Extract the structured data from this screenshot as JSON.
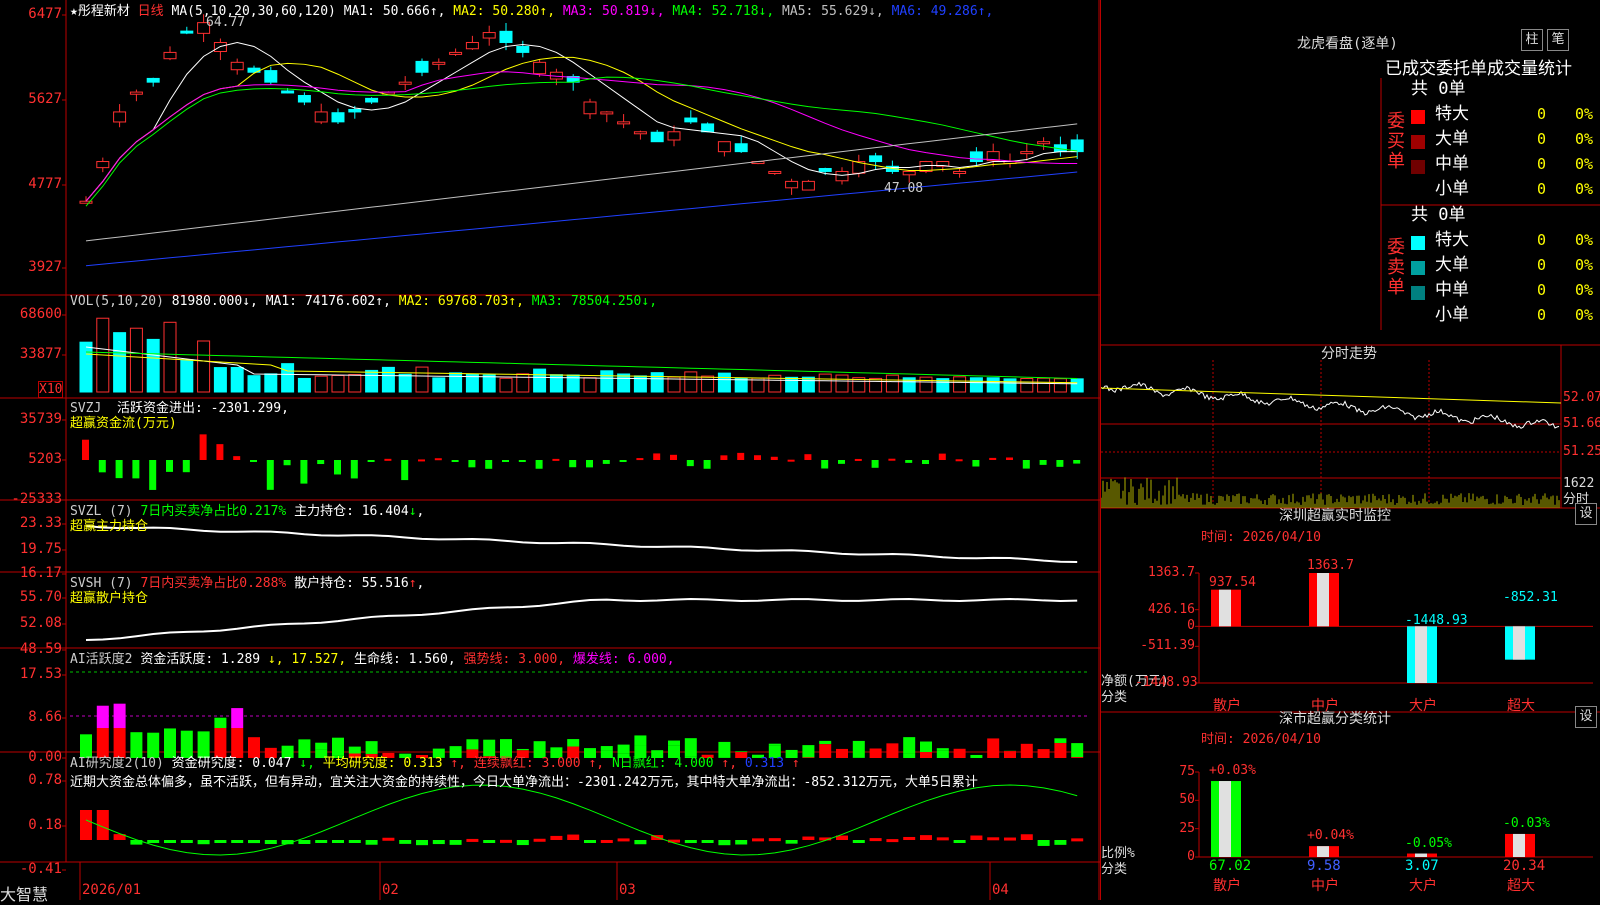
{
  "app": {
    "name": "大智慧",
    "stock": "★彤程新材",
    "period": "日线"
  },
  "main_chart": {
    "ma_label": "MA(5,10,20,30,60,120)",
    "ma": [
      {
        "name": "MA1",
        "value": "50.666",
        "arrow": "↑",
        "color": "#ffffff"
      },
      {
        "name": "MA2",
        "value": "50.280",
        "arrow": "↑",
        "color": "#ffff00"
      },
      {
        "name": "MA3",
        "value": "50.819",
        "arrow": "↓",
        "color": "#ff00ff"
      },
      {
        "name": "MA4",
        "value": "52.718",
        "arrow": "↓",
        "color": "#00ff00"
      },
      {
        "name": "MA5",
        "value": "55.629",
        "arrow": "↓",
        "color": "#c0c0c0"
      },
      {
        "name": "MA6",
        "value": "49.286",
        "arrow": "↑",
        "color": "#2040ff"
      }
    ],
    "yticks": [
      "6477",
      "5627",
      "4777",
      "3927"
    ],
    "high_label": "64.77",
    "low_label": "47.08"
  },
  "vol_panel": {
    "label": "VOL(5,10,20)",
    "value": "81980.000",
    "values": [
      {
        "name": "MA1",
        "value": "74176.602",
        "arrow": "↑",
        "color": "#ffffff"
      },
      {
        "name": "MA2",
        "value": "69768.703",
        "arrow": "↑",
        "color": "#ffff00"
      },
      {
        "name": "MA3",
        "value": "78504.250",
        "arrow": "↓",
        "color": "#00ff00"
      }
    ],
    "yticks": [
      "68600",
      "33877"
    ],
    "unit": "X10"
  },
  "svzj_panel": {
    "label": "SVZJ",
    "desc": "活跃资金进出:",
    "value": "-2301.299",
    "sub": "超赢资金流(万元)",
    "yticks": [
      "35739",
      "5203",
      "-25333"
    ]
  },
  "svzl_panel": {
    "label": "SVZL (7)",
    "desc": "7日内买卖净占比0.217%",
    "extra": "主力持仓: 16.404",
    "arrow": "↓",
    "sub": "超赢主力持仓",
    "yticks": [
      "23.33",
      "19.75",
      "16.17"
    ]
  },
  "svsh_panel": {
    "label": "SVSH (7)",
    "desc": "7日内买卖净占比0.288%",
    "extra": "散户持仓: 55.516",
    "arrow": "↑",
    "sub": "超赢散户持仓",
    "yticks": [
      "55.70",
      "52.08",
      "48.59"
    ]
  },
  "ai1_panel": {
    "label": "AI活跃度2",
    "items": [
      {
        "text": "资金活跃度: 1.289",
        "color": "#ffffff"
      },
      {
        "text": "↓, 17.527,",
        "color": "#ffff00"
      },
      {
        "text": "生命线: 1.560,",
        "color": "#ffffff"
      },
      {
        "text": "强势线: 3.000,",
        "color": "#ff3030"
      },
      {
        "text": "爆发线: 6.000,",
        "color": "#ff00ff"
      }
    ],
    "yticks": [
      "17.53",
      "8.66",
      "0.00"
    ]
  },
  "ai2_panel": {
    "label": "AI研究度2(10)",
    "items": [
      {
        "text": "资金研究度: 0.047",
        "color": "#ffffff"
      },
      {
        "text": "↓,",
        "color": "#00ff00"
      },
      {
        "text": "平均研究度: 0.313",
        "color": "#ffff00"
      },
      {
        "text": "↑,",
        "color": "#ff3030"
      },
      {
        "text": "连续飘红: 3.000",
        "color": "#ff3030"
      },
      {
        "text": "↑,",
        "color": "#ff3030"
      },
      {
        "text": "N日飘红: 4.000",
        "color": "#00ff00"
      },
      {
        "text": "↑,",
        "color": "#ff3030"
      },
      {
        "text": "0.313",
        "color": "#2040ff"
      },
      {
        "text": "↑",
        "color": "#ff3030"
      }
    ],
    "comment": "近期大资金总体偏多，虽不活跃，但有异动，宜关注大资金的持续性，今日大单净流出：-2301.242万元，其中特大单净流出：-852.312万元，大单5日累计",
    "yticks": [
      "0.78",
      "0.18",
      "-0.41"
    ]
  },
  "xaxis": [
    "2026/01",
    "02",
    "03",
    "04"
  ],
  "side": {
    "lhb": {
      "title": "龙虎看盘(逐单)",
      "btn1": "柱",
      "btn2": "笔",
      "tabs": "已成交委托单成交量统计",
      "buy": {
        "label": "委买单",
        "total": "共 0单",
        "rows": [
          {
            "name": "特大",
            "count": "0",
            "pct": "0%",
            "color": "#ff0000"
          },
          {
            "name": "大单",
            "count": "0",
            "pct": "0%",
            "color": "#a00000"
          },
          {
            "name": "中单",
            "count": "0",
            "pct": "0%",
            "color": "#700000"
          },
          {
            "name": "小单",
            "count": "0",
            "pct": "0%",
            "color": "#000000"
          }
        ]
      },
      "sell": {
        "label": "委卖单",
        "total": "共 0单",
        "rows": [
          {
            "name": "特大",
            "count": "0",
            "pct": "0%",
            "color": "#00ffff"
          },
          {
            "name": "大单",
            "count": "0",
            "pct": "0%",
            "color": "#00a0a0"
          },
          {
            "name": "中单",
            "count": "0",
            "pct": "0%",
            "color": "#008080"
          },
          {
            "name": "小单",
            "count": "0",
            "pct": "0%",
            "color": "#000000"
          }
        ]
      }
    },
    "fenshi": {
      "title": "分时走势",
      "yticks": [
        "52.07",
        "51.66",
        "51.25"
      ],
      "vol_tick": "1622",
      "vol_unit": "分时"
    },
    "sz_monitor": {
      "title": "深圳超赢实时监控",
      "btn": "设",
      "time": "时间: 2026/04/10",
      "yticks": [
        "1363.7",
        "426.16",
        "0",
        "-511.39",
        "-1448.93"
      ],
      "ylabel": "净额(万元)",
      "xlabel_title": "分类",
      "categories": [
        "散户",
        "中户",
        "大户",
        "超大"
      ],
      "values": [
        937.54,
        1363.7,
        -1448.93,
        -852.31
      ],
      "value_labels": [
        "937.54",
        "1363.7",
        "-1448.93",
        "-852.31"
      ],
      "ylim": [
        -1448.93,
        1363.7
      ]
    },
    "sz_class": {
      "title": "深市超赢分类统计",
      "btn": "设",
      "time": "时间: 2026/04/10",
      "yticks": [
        "75",
        "50",
        "25",
        "0"
      ],
      "ylabel": "比例%",
      "xlabel_title": "分类",
      "categories": [
        "散户",
        "中户",
        "大户",
        "超大"
      ],
      "values": [
        67.02,
        9.58,
        3.07,
        20.34
      ],
      "value_labels": [
        "67.02",
        "9.58",
        "3.07",
        "20.34"
      ],
      "changes": [
        "+0.03%",
        "+0.04%",
        "-0.05%",
        "-0.03%"
      ],
      "ylim": [
        0,
        75
      ]
    }
  },
  "chart_data": [
    {
      "type": "bar",
      "title": "深圳超赢实时监控",
      "ylabel": "净额(万元)",
      "categories": [
        "散户",
        "中户",
        "大户",
        "超大"
      ],
      "values": [
        937.54,
        1363.7,
        -1448.93,
        -852.31
      ],
      "ylim": [
        -1448.93,
        1363.7
      ]
    },
    {
      "type": "bar",
      "title": "深市超赢分类统计",
      "ylabel": "比例%",
      "categories": [
        "散户",
        "中户",
        "大户",
        "超大"
      ],
      "values": [
        67.02,
        9.58,
        3.07,
        20.34
      ],
      "ylim": [
        0,
        75
      ]
    }
  ]
}
